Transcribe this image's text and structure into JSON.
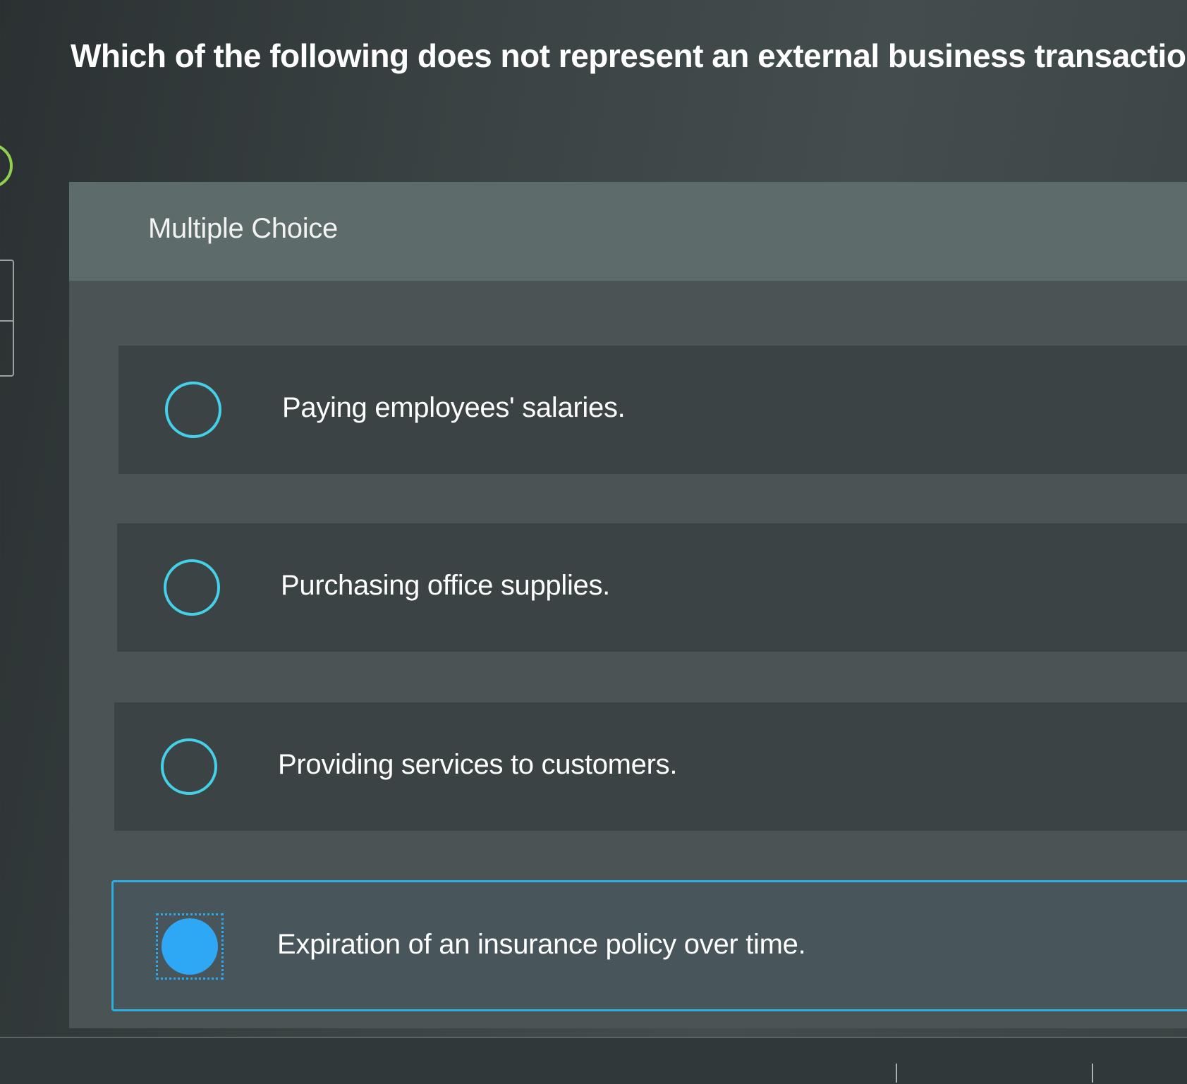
{
  "question": {
    "text": "Which of the following does not represent an external business transaction?"
  },
  "panel": {
    "label": "Multiple Choice"
  },
  "options": [
    {
      "label": "Paying employees' salaries.",
      "selected": false
    },
    {
      "label": "Purchasing office supplies.",
      "selected": false
    },
    {
      "label": "Providing services to customers.",
      "selected": false
    },
    {
      "label": "Expiration of an insurance policy over time.",
      "selected": true
    }
  ],
  "colors": {
    "accent": "#2eaee0",
    "radio_ring": "#44d0e8",
    "selected_fill": "#2ea8f5",
    "timer_ring": "#8fd14f"
  }
}
